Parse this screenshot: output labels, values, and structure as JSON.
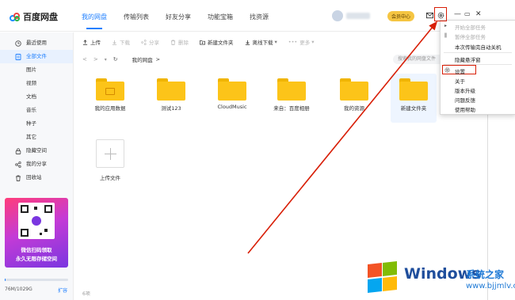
{
  "app": {
    "name": "百度网盘"
  },
  "nav": [
    {
      "label": "我的网盘"
    },
    {
      "label": "传输列表"
    },
    {
      "label": "好友分享"
    },
    {
      "label": "功能宝箱"
    },
    {
      "label": "找资源"
    }
  ],
  "header": {
    "vip_label": "会员中心"
  },
  "sidebar": {
    "items": [
      {
        "label": "最近使用",
        "icon": "clock-icon"
      },
      {
        "label": "全部文件",
        "icon": "file-icon"
      },
      {
        "label": "图片"
      },
      {
        "label": "视频"
      },
      {
        "label": "文档"
      },
      {
        "label": "音乐"
      },
      {
        "label": "种子"
      },
      {
        "label": "其它"
      },
      {
        "label": "隐藏空间",
        "icon": "lock-icon"
      },
      {
        "label": "我的分享",
        "icon": "share-icon"
      },
      {
        "label": "回收站",
        "icon": "trash-icon"
      }
    ],
    "promo": {
      "line1": "微信扫码领取",
      "line2": "永久无限存储空间"
    },
    "storage": {
      "text": "76M/1029G",
      "used_fraction": 0.0001,
      "expand_label": "扩容"
    }
  },
  "toolbar": {
    "buttons": [
      {
        "label": "上传",
        "enabled": true
      },
      {
        "label": "下载",
        "enabled": false
      },
      {
        "label": "分享",
        "enabled": false
      },
      {
        "label": "删除",
        "enabled": false
      },
      {
        "label": "新建文件夹",
        "enabled": true
      },
      {
        "label": "离线下载",
        "enabled": true
      },
      {
        "label": "更多",
        "enabled": false
      }
    ]
  },
  "path": {
    "crumb": "我的网盘",
    "separator": ">",
    "search_placeholder": "搜索我的网盘文件"
  },
  "files": [
    {
      "name": "我的应用数据"
    },
    {
      "name": "测试123"
    },
    {
      "name": "CloudMusic"
    },
    {
      "name": "来自：百度相册"
    },
    {
      "name": "我的资源"
    },
    {
      "name": "新建文件夹"
    }
  ],
  "upload_label": "上传文件",
  "item_count": "6项",
  "settings_menu": {
    "items": [
      {
        "label": "开始全部任务",
        "enabled": false
      },
      {
        "label": "暂停全部任务",
        "enabled": false
      },
      {
        "label": "本次传输完自动关机",
        "enabled": true
      },
      {
        "label": "隐藏悬浮窗",
        "enabled": true
      },
      {
        "label": "设置",
        "enabled": true,
        "highlighted": true
      },
      {
        "label": "关于",
        "enabled": true
      },
      {
        "label": "版本升级",
        "enabled": true
      },
      {
        "label": "问题反馈",
        "enabled": true
      },
      {
        "label": "使用帮助",
        "enabled": true
      }
    ]
  },
  "watermark": {
    "title": "Windows",
    "subtitle": "系统之家",
    "url": "www.bjjmlv.com"
  },
  "colors": {
    "accent": "#1e7fff",
    "annotation": "#d81e06",
    "folder": "#fcc419"
  }
}
